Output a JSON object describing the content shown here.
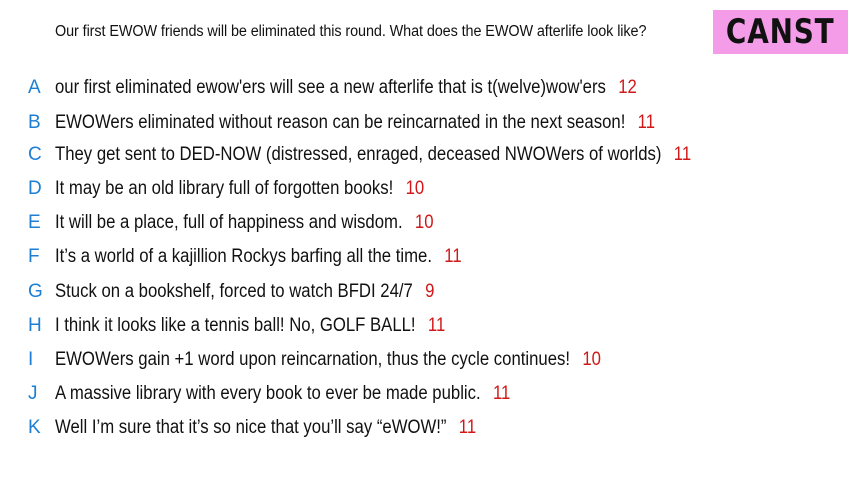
{
  "prompt": "Our first EWOW friends will be eliminated this round. What does the EWOW afterlife look like?",
  "badge": "CANST",
  "colors": {
    "letter": "#1c7fd4",
    "score": "#d01818",
    "badge_bg": "#f59ce9"
  },
  "answers": [
    {
      "letter": "A",
      "text": "our first eliminated ewow'ers will see a new afterlife that is t(welve)wow'ers",
      "score": "12"
    },
    {
      "letter": "B",
      "text": "EWOWers eliminated without reason can be reincarnated in the next season!",
      "score": "11"
    },
    {
      "letter": "C",
      "text": "They get sent to DED-NOW (distressed, enraged, deceased NWOWers of worlds)",
      "score": "11"
    },
    {
      "letter": "D",
      "text": "It may be an old library full of forgotten books!",
      "score": "10"
    },
    {
      "letter": "E",
      "text": "It will be a place, full of happiness and wisdom.",
      "score": "10"
    },
    {
      "letter": "F",
      "text": "It’s a world of a kajillion Rockys barfing all the time.",
      "score": "11"
    },
    {
      "letter": "G",
      "text": "Stuck on a bookshelf, forced to watch BFDI 24/7",
      "score": "9"
    },
    {
      "letter": "H",
      "text": "I think it looks like a tennis ball! No, GOLF BALL!",
      "score": "11"
    },
    {
      "letter": "I",
      "text": "EWOWers gain +1 word upon reincarnation, thus the cycle continues!",
      "score": "10"
    },
    {
      "letter": "J",
      "text": "A massive library with every book to ever be made public.",
      "score": "11"
    },
    {
      "letter": "K",
      "text": "Well I’m sure that it’s so nice that you’ll say “eWOW!”",
      "score": "11"
    }
  ]
}
